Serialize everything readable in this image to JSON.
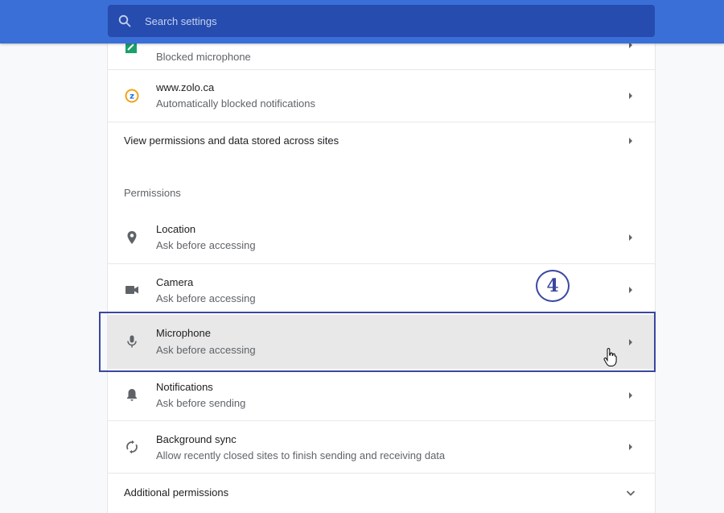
{
  "search": {
    "placeholder": "Search settings"
  },
  "sites": [
    {
      "subtitle": "Blocked microphone"
    },
    {
      "title": "www.zolo.ca",
      "subtitle": "Automatically blocked notifications",
      "favicon_letter": "z"
    }
  ],
  "view_all": "View permissions and data stored across sites",
  "permissions": {
    "heading": "Permissions",
    "items": [
      {
        "title": "Location",
        "subtitle": "Ask before accessing",
        "icon": "location-pin-icon"
      },
      {
        "title": "Camera",
        "subtitle": "Ask before accessing",
        "icon": "camera-icon"
      },
      {
        "title": "Microphone",
        "subtitle": "Ask before accessing",
        "icon": "microphone-icon"
      },
      {
        "title": "Notifications",
        "subtitle": "Ask before sending",
        "icon": "bell-icon"
      },
      {
        "title": "Background sync",
        "subtitle": "Allow recently closed sites to finish sending and receiving data",
        "icon": "sync-icon"
      }
    ]
  },
  "additional": "Additional permissions",
  "annotation": {
    "step": "4"
  },
  "colors": {
    "header": "#3b6fd8",
    "search_bg": "#254cae",
    "highlight": "#e8e8e8",
    "callout": "#3a47a0"
  }
}
